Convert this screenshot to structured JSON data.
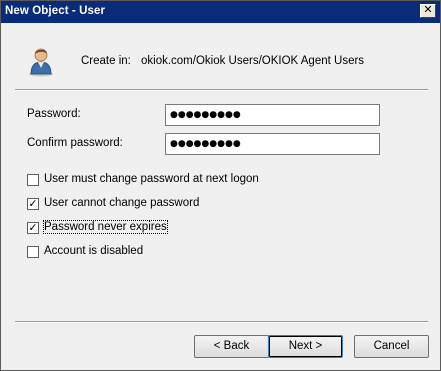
{
  "window": {
    "title": "New Object - User",
    "close_glyph": "✕"
  },
  "header": {
    "icon": "user-icon",
    "create_in_label": "Create in:",
    "create_in_path": "okiok.com/Okiok Users/OKIOK Agent Users"
  },
  "form": {
    "password_label": "Password:",
    "password_value": "●●●●●●●●●",
    "confirm_label": "Confirm password:",
    "confirm_value": "●●●●●●●●●"
  },
  "options": [
    {
      "label": "User must change password at next logon",
      "checked": false
    },
    {
      "label": "User cannot change password",
      "checked": true
    },
    {
      "label": "Password never expires",
      "checked": true
    },
    {
      "label": "Account is disabled",
      "checked": false
    }
  ],
  "buttons": {
    "back": "< Back",
    "next": "Next >",
    "cancel": "Cancel"
  },
  "colors": {
    "titlebar": "#0a2b7a",
    "dialog_bg": "#f0f0f0"
  }
}
